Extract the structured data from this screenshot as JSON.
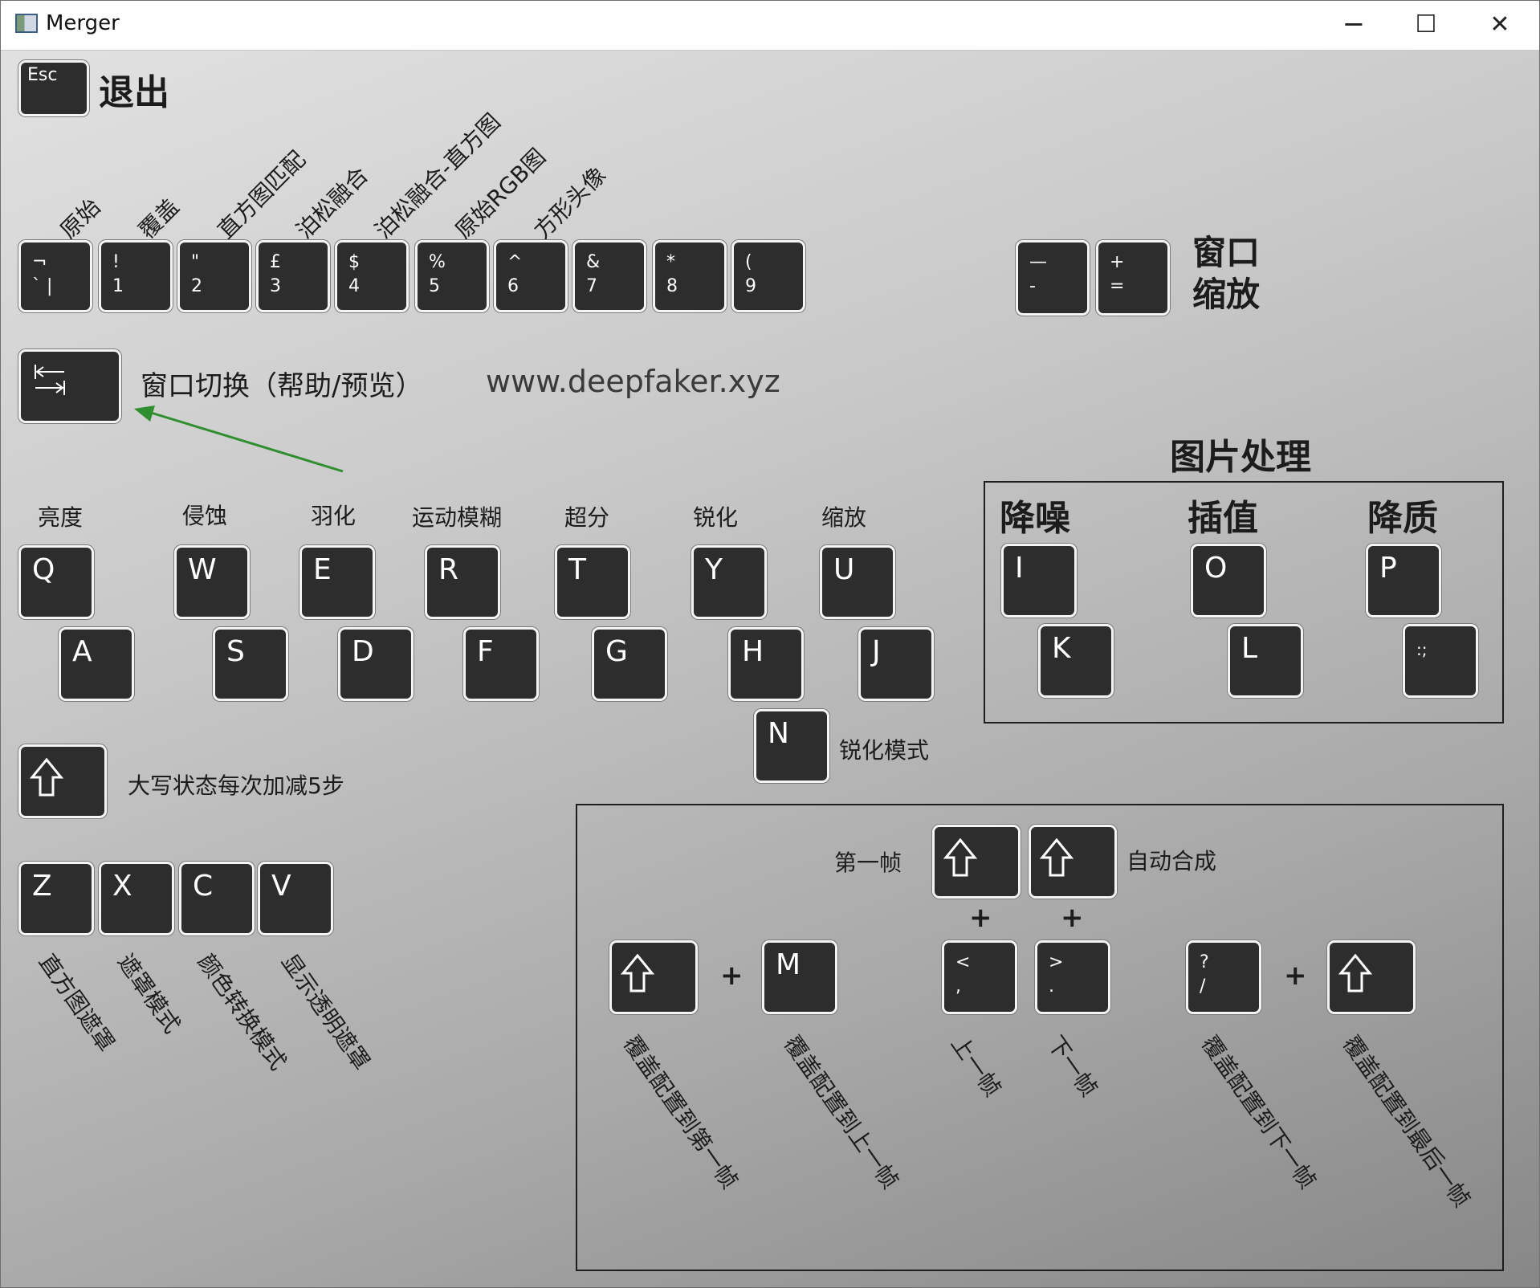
{
  "window": {
    "title": "Merger",
    "minimize": "─",
    "maximize": "☐",
    "close": "✕"
  },
  "esc": {
    "key": "Esc",
    "label": "退出"
  },
  "number_row": {
    "labels": [
      "原始",
      "覆盖",
      "直方图匹配",
      "泊松融合",
      "泊松融合-直方图",
      "原始RGB图",
      "方形头像"
    ],
    "keys": [
      {
        "top": "¬",
        "bottom": "` |"
      },
      {
        "top": "!",
        "bottom": "1"
      },
      {
        "top": "\"",
        "bottom": "2"
      },
      {
        "top": "£",
        "bottom": "3"
      },
      {
        "top": "$",
        "bottom": "4"
      },
      {
        "top": "%",
        "bottom": "5"
      },
      {
        "top": "^",
        "bottom": "6"
      },
      {
        "top": "&",
        "bottom": "7"
      },
      {
        "top": "*",
        "bottom": "8"
      },
      {
        "top": "(",
        "bottom": "9"
      }
    ]
  },
  "zoom": {
    "minus_top": "—",
    "minus_bottom": "-",
    "plus_top": "+",
    "plus_bottom": "=",
    "label_line1": "窗口",
    "label_line2": "缩放"
  },
  "tab": {
    "label": "窗口切换（帮助/预览）",
    "url": "www.deepfaker.xyz"
  },
  "adjust": {
    "labels": [
      "亮度",
      "侵蚀",
      "羽化",
      "运动模糊",
      "超分",
      "锐化",
      "缩放"
    ],
    "top_keys": [
      "Q",
      "W",
      "E",
      "R",
      "T",
      "Y",
      "U"
    ],
    "bottom_keys": [
      "A",
      "S",
      "D",
      "F",
      "G",
      "H",
      "J"
    ],
    "n_key": "N",
    "n_label": "锐化模式"
  },
  "image_processing": {
    "title": "图片处理",
    "labels": [
      "降噪",
      "插值",
      "降质"
    ],
    "top_keys": [
      "I",
      "O",
      "P"
    ],
    "bottom_keys": [
      "K",
      "L",
      ":;"
    ]
  },
  "shift": {
    "label": "大写状态每次加减5步"
  },
  "mask": {
    "keys": [
      "Z",
      "X",
      "C",
      "V"
    ],
    "labels": [
      "直方图遮罩",
      "遮罩模式",
      "颜色转换模式",
      "显示透明遮罩"
    ]
  },
  "frames": {
    "first_label": "第一帧",
    "auto_label": "自动合成",
    "plus": "+",
    "m_key": "M",
    "lt_top": "<",
    "lt_bottom": ",",
    "gt_top": ">",
    "gt_bottom": ".",
    "q_top": "?",
    "q_bottom": "/",
    "rot_labels": [
      "覆盖配置到第一帧",
      "覆盖配置到上一帧",
      "上一帧",
      "下一帧",
      "覆盖配置到下一帧",
      "覆盖配置到最后一帧"
    ]
  }
}
